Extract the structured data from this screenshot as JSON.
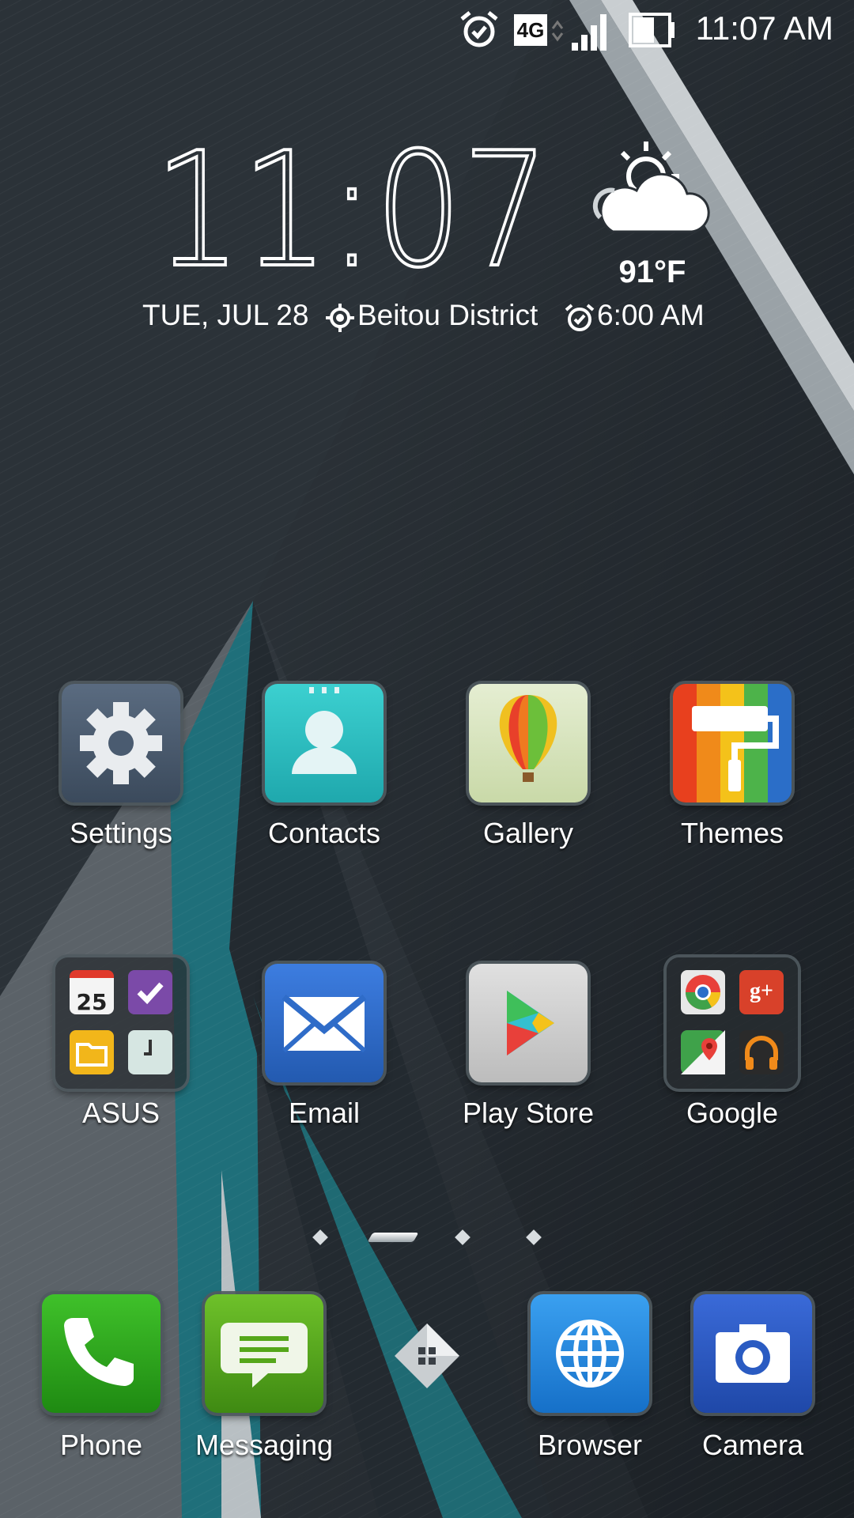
{
  "status_bar": {
    "time": "11:07 AM",
    "network": "4G",
    "icons": [
      "alarm-icon",
      "network-4g-icon",
      "signal-icon",
      "battery-icon"
    ]
  },
  "clock_widget": {
    "time": "11:07",
    "date": "TUE, JUL 28",
    "location": "Beitou District",
    "alarm": "6:00 AM",
    "temperature": "91°F",
    "weather_icon": "partly-cloudy-icon"
  },
  "apps": [
    {
      "label": "Settings",
      "icon": "gear-icon"
    },
    {
      "label": "Contacts",
      "icon": "person-icon"
    },
    {
      "label": "Gallery",
      "icon": "hot-air-balloon-icon"
    },
    {
      "label": "Themes",
      "icon": "paint-roller-icon"
    },
    {
      "label": "ASUS",
      "icon": "folder-icon"
    },
    {
      "label": "Email",
      "icon": "envelope-icon"
    },
    {
      "label": "Play Store",
      "icon": "play-store-icon"
    },
    {
      "label": "Google",
      "icon": "folder-icon"
    }
  ],
  "asus_folder": {
    "calendar_day": "25"
  },
  "google_folder": {
    "gplus": "g+"
  },
  "page_indicator": {
    "pages": 4,
    "current": 2
  },
  "dock": [
    {
      "label": "Phone",
      "icon": "phone-icon"
    },
    {
      "label": "Messaging",
      "icon": "message-icon"
    },
    {
      "label": "Browser",
      "icon": "globe-icon"
    },
    {
      "label": "Camera",
      "icon": "camera-icon"
    }
  ],
  "all_apps_button": {
    "icon": "all-apps-icon"
  },
  "colors": {
    "settings_bg": "#4a5b70",
    "contacts_bg": "#2bbfc2",
    "gallery_bg": "#d8e6c0",
    "email_bg": "#2f6cc8",
    "playstore_bg": "#d0d0d0",
    "phone_bg": "#2ea31a",
    "messaging_bg": "#55a71a",
    "browser_bg": "#1f8ae6",
    "camera_bg": "#2a5bc2",
    "wallpaper_teal": "#1f6f7a"
  }
}
